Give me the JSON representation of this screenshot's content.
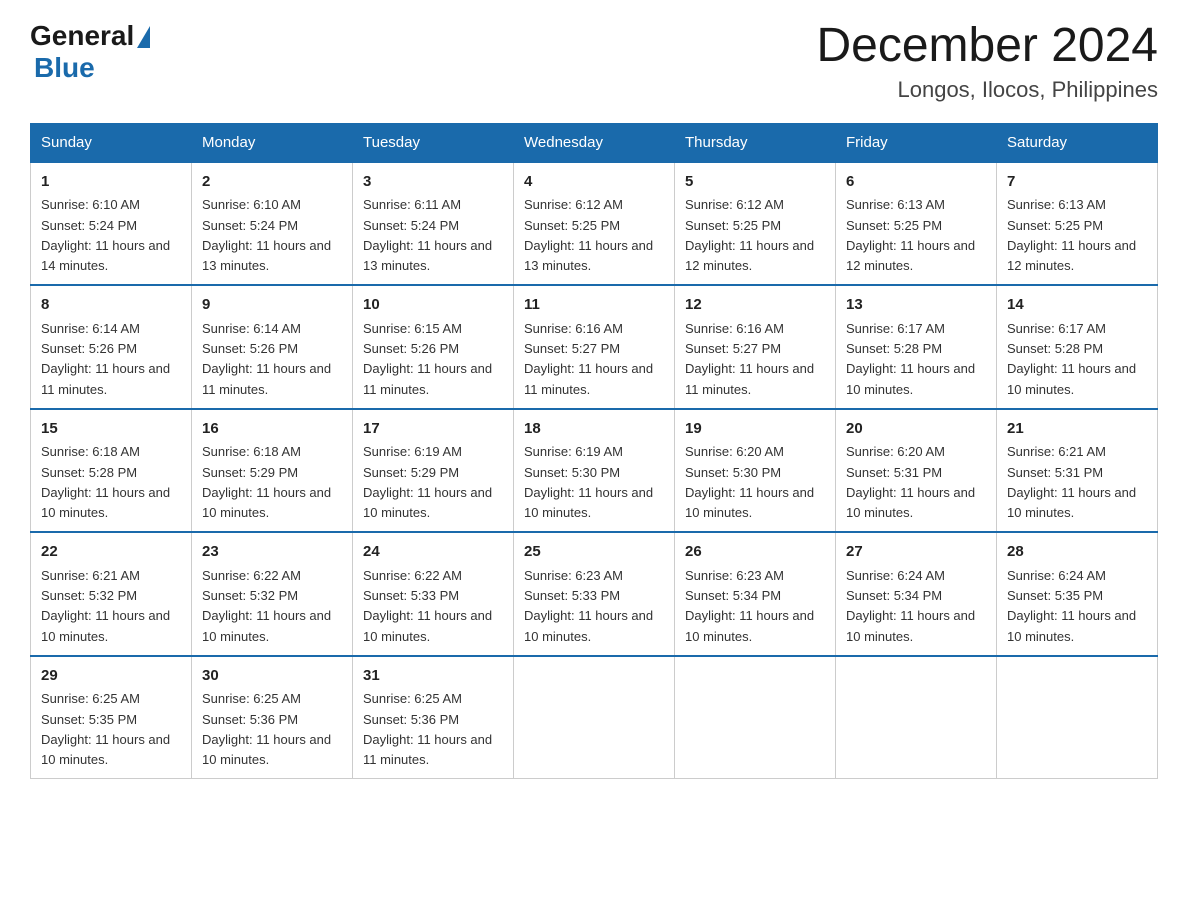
{
  "logo": {
    "text_general": "General",
    "text_blue": "Blue"
  },
  "title": "December 2024",
  "subtitle": "Longos, Ilocos, Philippines",
  "days_of_week": [
    "Sunday",
    "Monday",
    "Tuesday",
    "Wednesday",
    "Thursday",
    "Friday",
    "Saturday"
  ],
  "weeks": [
    [
      {
        "day": "1",
        "sunrise": "6:10 AM",
        "sunset": "5:24 PM",
        "daylight": "11 hours and 14 minutes."
      },
      {
        "day": "2",
        "sunrise": "6:10 AM",
        "sunset": "5:24 PM",
        "daylight": "11 hours and 13 minutes."
      },
      {
        "day": "3",
        "sunrise": "6:11 AM",
        "sunset": "5:24 PM",
        "daylight": "11 hours and 13 minutes."
      },
      {
        "day": "4",
        "sunrise": "6:12 AM",
        "sunset": "5:25 PM",
        "daylight": "11 hours and 13 minutes."
      },
      {
        "day": "5",
        "sunrise": "6:12 AM",
        "sunset": "5:25 PM",
        "daylight": "11 hours and 12 minutes."
      },
      {
        "day": "6",
        "sunrise": "6:13 AM",
        "sunset": "5:25 PM",
        "daylight": "11 hours and 12 minutes."
      },
      {
        "day": "7",
        "sunrise": "6:13 AM",
        "sunset": "5:25 PM",
        "daylight": "11 hours and 12 minutes."
      }
    ],
    [
      {
        "day": "8",
        "sunrise": "6:14 AM",
        "sunset": "5:26 PM",
        "daylight": "11 hours and 11 minutes."
      },
      {
        "day": "9",
        "sunrise": "6:14 AM",
        "sunset": "5:26 PM",
        "daylight": "11 hours and 11 minutes."
      },
      {
        "day": "10",
        "sunrise": "6:15 AM",
        "sunset": "5:26 PM",
        "daylight": "11 hours and 11 minutes."
      },
      {
        "day": "11",
        "sunrise": "6:16 AM",
        "sunset": "5:27 PM",
        "daylight": "11 hours and 11 minutes."
      },
      {
        "day": "12",
        "sunrise": "6:16 AM",
        "sunset": "5:27 PM",
        "daylight": "11 hours and 11 minutes."
      },
      {
        "day": "13",
        "sunrise": "6:17 AM",
        "sunset": "5:28 PM",
        "daylight": "11 hours and 10 minutes."
      },
      {
        "day": "14",
        "sunrise": "6:17 AM",
        "sunset": "5:28 PM",
        "daylight": "11 hours and 10 minutes."
      }
    ],
    [
      {
        "day": "15",
        "sunrise": "6:18 AM",
        "sunset": "5:28 PM",
        "daylight": "11 hours and 10 minutes."
      },
      {
        "day": "16",
        "sunrise": "6:18 AM",
        "sunset": "5:29 PM",
        "daylight": "11 hours and 10 minutes."
      },
      {
        "day": "17",
        "sunrise": "6:19 AM",
        "sunset": "5:29 PM",
        "daylight": "11 hours and 10 minutes."
      },
      {
        "day": "18",
        "sunrise": "6:19 AM",
        "sunset": "5:30 PM",
        "daylight": "11 hours and 10 minutes."
      },
      {
        "day": "19",
        "sunrise": "6:20 AM",
        "sunset": "5:30 PM",
        "daylight": "11 hours and 10 minutes."
      },
      {
        "day": "20",
        "sunrise": "6:20 AM",
        "sunset": "5:31 PM",
        "daylight": "11 hours and 10 minutes."
      },
      {
        "day": "21",
        "sunrise": "6:21 AM",
        "sunset": "5:31 PM",
        "daylight": "11 hours and 10 minutes."
      }
    ],
    [
      {
        "day": "22",
        "sunrise": "6:21 AM",
        "sunset": "5:32 PM",
        "daylight": "11 hours and 10 minutes."
      },
      {
        "day": "23",
        "sunrise": "6:22 AM",
        "sunset": "5:32 PM",
        "daylight": "11 hours and 10 minutes."
      },
      {
        "day": "24",
        "sunrise": "6:22 AM",
        "sunset": "5:33 PM",
        "daylight": "11 hours and 10 minutes."
      },
      {
        "day": "25",
        "sunrise": "6:23 AM",
        "sunset": "5:33 PM",
        "daylight": "11 hours and 10 minutes."
      },
      {
        "day": "26",
        "sunrise": "6:23 AM",
        "sunset": "5:34 PM",
        "daylight": "11 hours and 10 minutes."
      },
      {
        "day": "27",
        "sunrise": "6:24 AM",
        "sunset": "5:34 PM",
        "daylight": "11 hours and 10 minutes."
      },
      {
        "day": "28",
        "sunrise": "6:24 AM",
        "sunset": "5:35 PM",
        "daylight": "11 hours and 10 minutes."
      }
    ],
    [
      {
        "day": "29",
        "sunrise": "6:25 AM",
        "sunset": "5:35 PM",
        "daylight": "11 hours and 10 minutes."
      },
      {
        "day": "30",
        "sunrise": "6:25 AM",
        "sunset": "5:36 PM",
        "daylight": "11 hours and 10 minutes."
      },
      {
        "day": "31",
        "sunrise": "6:25 AM",
        "sunset": "5:36 PM",
        "daylight": "11 hours and 11 minutes."
      },
      {
        "day": "",
        "sunrise": "",
        "sunset": "",
        "daylight": ""
      },
      {
        "day": "",
        "sunrise": "",
        "sunset": "",
        "daylight": ""
      },
      {
        "day": "",
        "sunrise": "",
        "sunset": "",
        "daylight": ""
      },
      {
        "day": "",
        "sunrise": "",
        "sunset": "",
        "daylight": ""
      }
    ]
  ]
}
